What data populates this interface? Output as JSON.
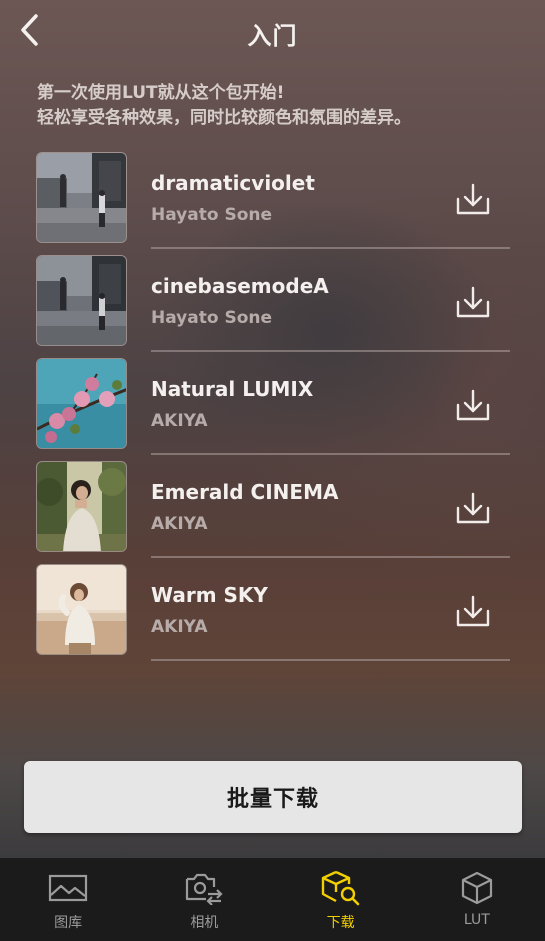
{
  "header": {
    "title": "入门",
    "back_icon": "chevron-left-icon"
  },
  "intro": {
    "line1": "第一次使用LUT就从这个包开始!",
    "line2": "轻松享受各种效果，同时比较颜色和氛围的差异。"
  },
  "luts": [
    {
      "name": "dramaticviolet",
      "author": "Hayato Sone",
      "action_icon": "download-icon"
    },
    {
      "name": "cinebasemodeA",
      "author": "Hayato Sone",
      "action_icon": "download-icon"
    },
    {
      "name": "Natural LUMIX",
      "author": "AKIYA",
      "action_icon": "download-icon"
    },
    {
      "name": "Emerald CINEMA",
      "author": "AKIYA",
      "action_icon": "download-icon"
    },
    {
      "name": "Warm SKY",
      "author": "AKIYA",
      "action_icon": "download-icon"
    }
  ],
  "batch_download_label": "批量下载",
  "tabbar": {
    "tabs": [
      {
        "label": "图库",
        "icon": "gallery-icon",
        "active": false
      },
      {
        "label": "相机",
        "icon": "camera-switch-icon",
        "active": false
      },
      {
        "label": "下载",
        "icon": "cube-search-icon",
        "active": true
      },
      {
        "label": "LUT",
        "icon": "cube-icon",
        "active": false
      }
    ]
  },
  "colors": {
    "accent": "#f2cf00",
    "tabbar_bg": "#1b1b1b",
    "button_bg": "#e6e6e6"
  }
}
